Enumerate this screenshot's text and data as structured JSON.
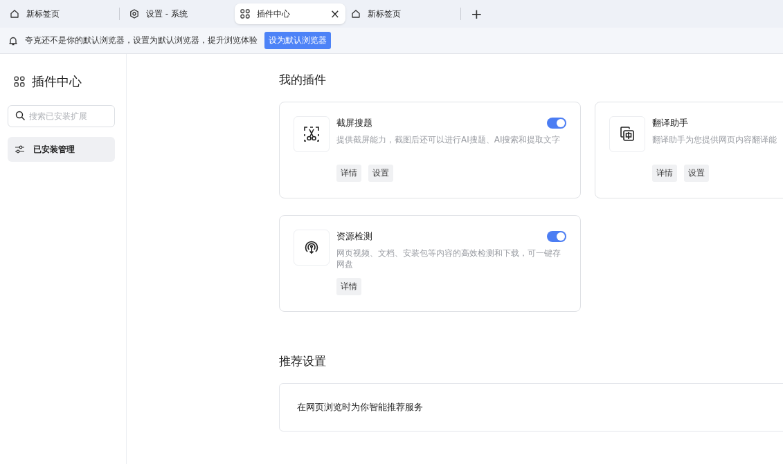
{
  "tabs": [
    {
      "label": "新标签页",
      "kind": "home",
      "selected": false
    },
    {
      "label": "设置 - 系统",
      "kind": "settings",
      "selected": false
    },
    {
      "label": "插件中心",
      "kind": "grid",
      "selected": true,
      "close": "×"
    },
    {
      "label": "新标签页",
      "kind": "home",
      "selected": false
    }
  ],
  "new_tab": "+",
  "notice": {
    "text": "夸克还不是你的默认浏览器，设置为默认浏览器，提升浏览体验",
    "button": "设为默认浏览器"
  },
  "sidebar": {
    "title": "插件中心",
    "search": {
      "placeholder": "搜索已安装扩展"
    },
    "items": [
      {
        "label": "已安装管理",
        "selected": true
      }
    ]
  },
  "my_plugins": {
    "heading": "我的插件",
    "plugins": [
      {
        "name": "截屏搜题",
        "kind": "scissors",
        "on": true,
        "description": "提供截屏能力，截图后还可以进行AI搜题、AI搜索和提取文字",
        "buttons": [
          "详情",
          "设置"
        ]
      },
      {
        "name": "翻译助手",
        "kind": "translate",
        "description": "翻译助手为您提供网页内容翻译能",
        "buttons": [
          "详情",
          "设置"
        ]
      },
      {
        "name": "资源检测",
        "kind": "signal",
        "on": true,
        "description": "网页视频、文档、安装包等内容的高效检测和下载，可一键存网盘",
        "buttons": [
          "详情"
        ]
      }
    ]
  },
  "recommend": {
    "heading": "推荐设置",
    "text": "在网页浏览时为你智能推荐服务"
  }
}
